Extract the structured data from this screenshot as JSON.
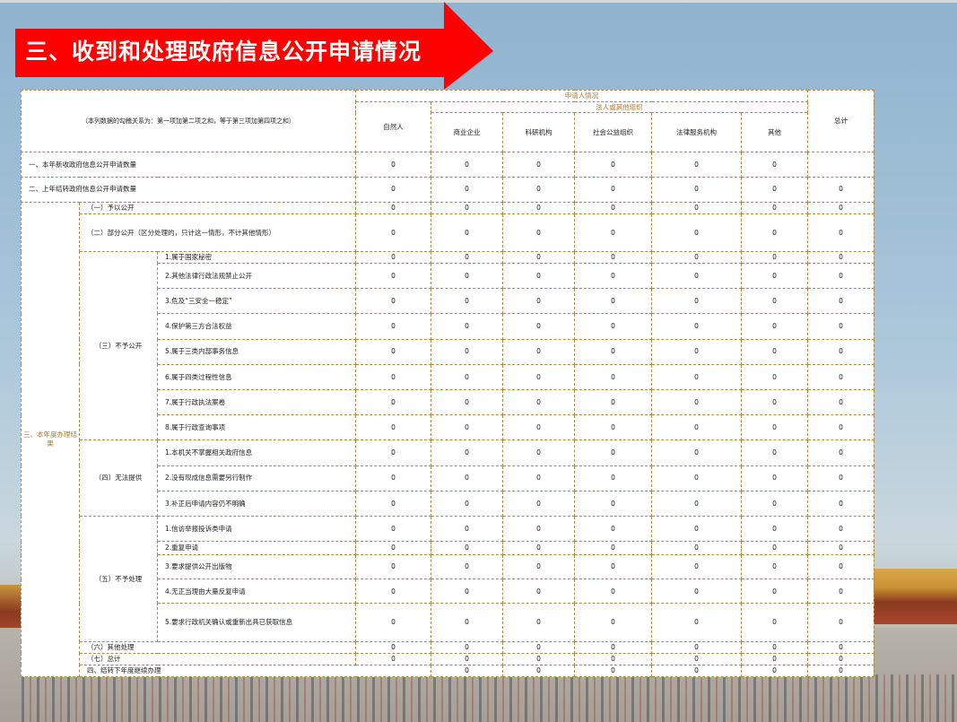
{
  "slide": {
    "title": "三、收到和处理政府信息公开申请情况",
    "arrow_color": "#ff0000"
  },
  "table": {
    "note": "（本列数据的勾稽关系为：第一项加第二项之和，等于第三项加第四项之和）",
    "header": {
      "applicant_group": "申请人情况",
      "natural_person": "自然人",
      "org_group": "法人或其他组织",
      "orgs": [
        "商业企业",
        "科研机构",
        "社会公益组织",
        "法律服务机构",
        "其他"
      ],
      "total": "总计"
    },
    "rows": [
      {
        "label": "一、本年新收政府信息公开申请数量",
        "values": [
          "0",
          "0",
          "0",
          "0",
          "0",
          "0",
          ""
        ]
      },
      {
        "label": "二、上年结转政府信息公开申请数量",
        "values": [
          "0",
          "0",
          "0",
          "0",
          "0",
          "0",
          "0"
        ]
      }
    ],
    "section3_label": "三、本年度办理结果",
    "s3": {
      "r1": {
        "label": "（一）予以公开",
        "values": [
          "0",
          "0",
          "0",
          "0",
          "0",
          "0",
          "0"
        ]
      },
      "r2": {
        "label": "（二）部分公开（区分处理的，只计这一情形，不计其他情形）",
        "values": [
          "0",
          "0",
          "0",
          "0",
          "0",
          "0",
          "0"
        ]
      },
      "g3": {
        "label": "（三）不予公开",
        "items": [
          {
            "label": "1.属于国家秘密",
            "values": [
              "0",
              "0",
              "0",
              "0",
              "0",
              "0",
              "0"
            ]
          },
          {
            "label": "2.其他法律行政法规禁止公开",
            "values": [
              "0",
              "0",
              "0",
              "0",
              "0",
              "0",
              "0"
            ]
          },
          {
            "label": "3.危及“三安全一稳定”",
            "values": [
              "0",
              "0",
              "0",
              "0",
              "0",
              "0",
              "0"
            ]
          },
          {
            "label": "4.保护第三方合法权益",
            "values": [
              "0",
              "0",
              "0",
              "0",
              "0",
              "0",
              "0"
            ]
          },
          {
            "label": "5.属于三类内部事务信息",
            "values": [
              "0",
              "0",
              "0",
              "0",
              "0",
              "0",
              "0"
            ]
          },
          {
            "label": "6.属于四类过程性信息",
            "values": [
              "0",
              "0",
              "0",
              "0",
              "0",
              "0",
              "0"
            ]
          },
          {
            "label": "7.属于行政执法案卷",
            "values": [
              "0",
              "0",
              "0",
              "0",
              "0",
              "0",
              "0"
            ]
          },
          {
            "label": "8.属于行政查询事项",
            "values": [
              "0",
              "0",
              "0",
              "0",
              "0",
              "0",
              "0"
            ]
          }
        ]
      },
      "g4": {
        "label": "（四）无法提供",
        "items": [
          {
            "label": "1.本机关不掌握相关政府信息",
            "values": [
              "0",
              "0",
              "0",
              "0",
              "0",
              "0",
              "0"
            ]
          },
          {
            "label": "2.没有现成信息需要另行制作",
            "values": [
              "0",
              "0",
              "0",
              "0",
              "0",
              "0",
              "0"
            ]
          },
          {
            "label": "3.补正后申请内容仍不明确",
            "values": [
              "0",
              "0",
              "0",
              "0",
              "0",
              "0",
              "0"
            ]
          }
        ]
      },
      "g5": {
        "label": "（五）不予处理",
        "items": [
          {
            "label": "1.信访举报投诉类申请",
            "values": [
              "0",
              "0",
              "0",
              "0",
              "0",
              "0",
              "0"
            ]
          },
          {
            "label": "2.重复申请",
            "values": [
              "0",
              "0",
              "0",
              "0",
              "0",
              "0",
              "0"
            ]
          },
          {
            "label": "3.要求提供公开出版物",
            "values": [
              "0",
              "0",
              "0",
              "0",
              "0",
              "0",
              "0"
            ]
          },
          {
            "label": "4.无正当理由大量反复申请",
            "values": [
              "0",
              "0",
              "0",
              "0",
              "0",
              "0",
              "0"
            ]
          },
          {
            "label": "5.要求行政机关确认或重新出具已获取信息",
            "values": [
              "0",
              "0",
              "0",
              "0",
              "0",
              "0",
              "0"
            ]
          }
        ]
      },
      "r6": {
        "label": "（六）其他处理",
        "values": [
          "0",
          "0",
          "0",
          "0",
          "0",
          "0",
          "0"
        ]
      },
      "r7": {
        "label": "（七）总计",
        "values": [
          "0",
          "0",
          "0",
          "0",
          "0",
          "0",
          "0"
        ]
      }
    },
    "row4": {
      "label": "四、结转下年度继续办理",
      "values": [
        "0",
        "0",
        "0",
        "0",
        "0",
        "0",
        "0"
      ]
    }
  }
}
